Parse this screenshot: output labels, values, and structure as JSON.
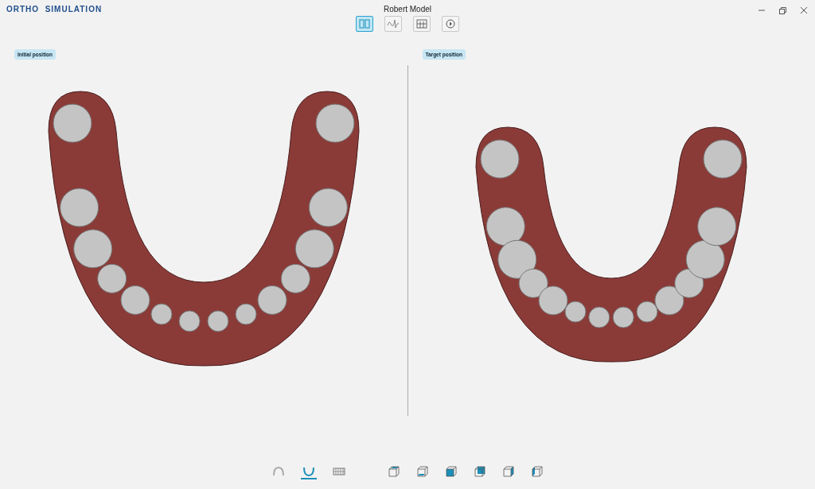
{
  "app": {
    "brand": "ORTHO  SIMULATION",
    "title": "Robert Model"
  },
  "view_modes": [
    {
      "kind": "split",
      "selected": true
    },
    {
      "kind": "wave",
      "selected": false
    },
    {
      "kind": "grid",
      "selected": false
    },
    {
      "kind": "play",
      "selected": false
    }
  ],
  "panels": [
    {
      "label": "Initial position",
      "kind": "initial"
    },
    {
      "label": "Target position",
      "kind": "target"
    }
  ],
  "jaw_toggles": [
    {
      "kind": "upper",
      "selected": false
    },
    {
      "kind": "lower",
      "selected": true
    },
    {
      "kind": "both",
      "selected": false
    }
  ],
  "view_cubes": [
    {
      "kind": "top"
    },
    {
      "kind": "bottom"
    },
    {
      "kind": "front"
    },
    {
      "kind": "back"
    },
    {
      "kind": "right"
    },
    {
      "kind": "left"
    }
  ]
}
